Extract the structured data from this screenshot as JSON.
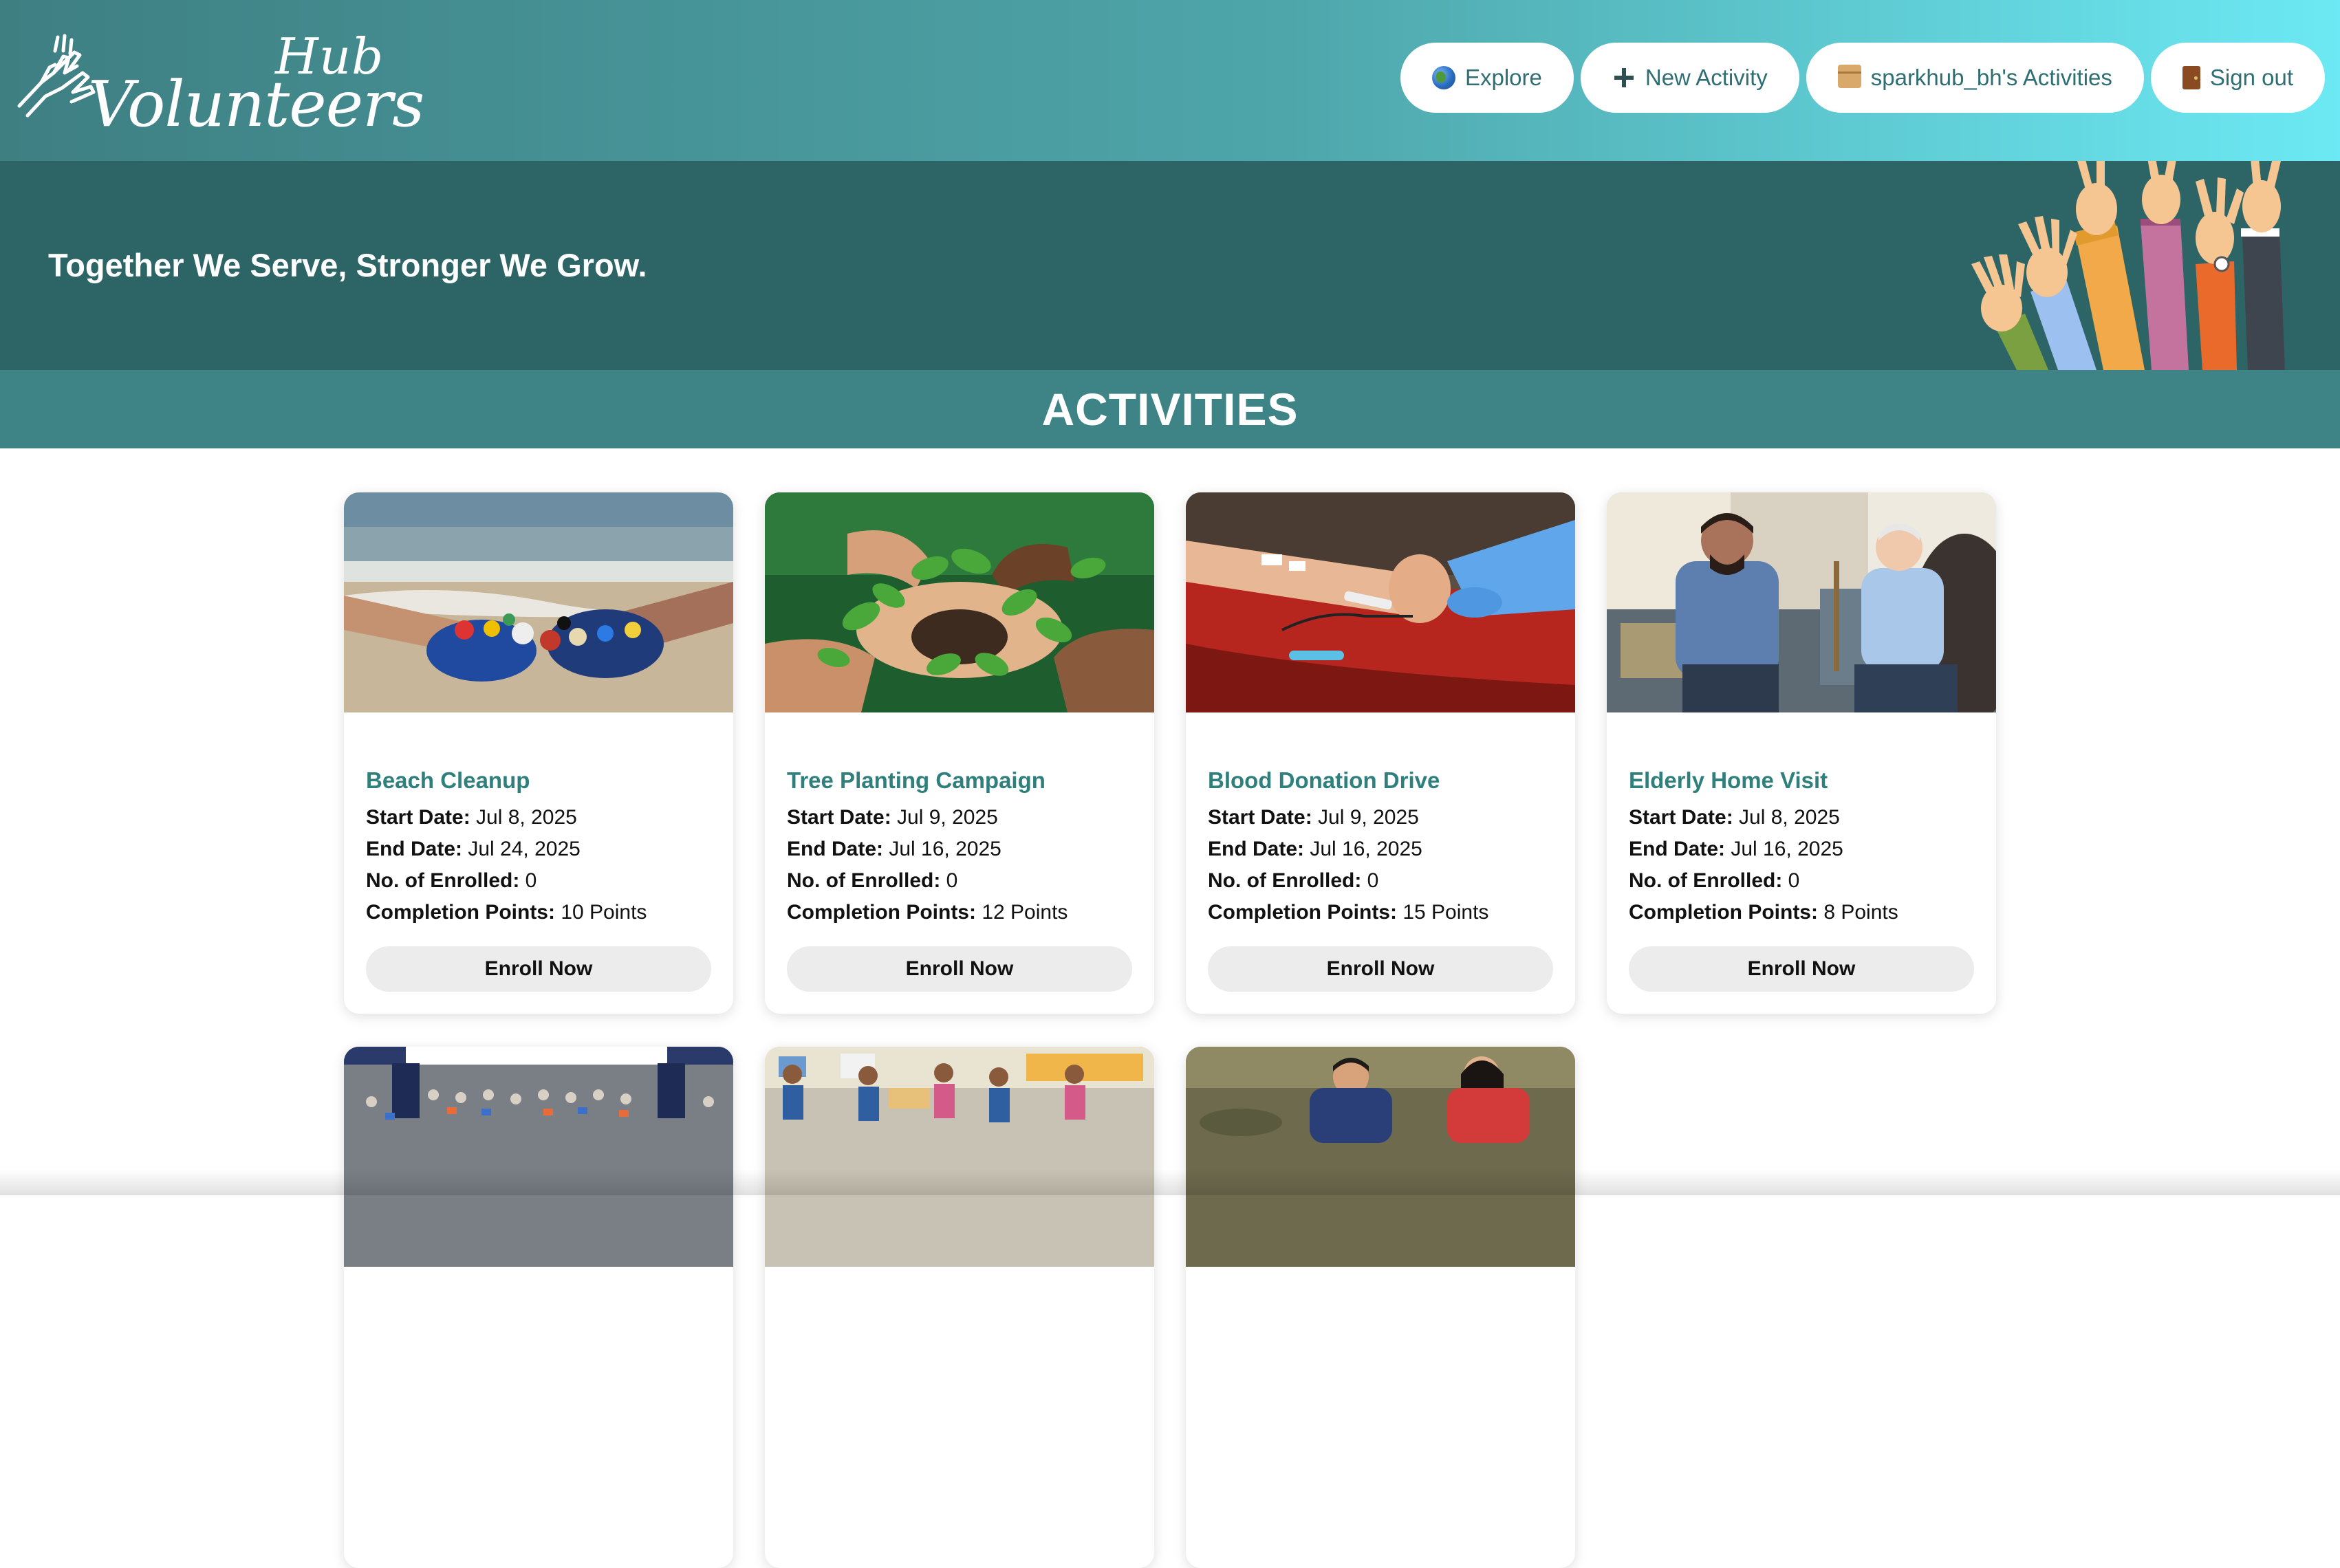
{
  "brand": {
    "logo_top": "Hub",
    "logo_bottom": "Volunteers"
  },
  "nav": {
    "explore": {
      "label": "Explore",
      "icon": "globe-icon"
    },
    "new_activity": {
      "label": "New Activity",
      "icon": "plus-icon"
    },
    "my_activities": {
      "label": "sparkhub_bh's Activities",
      "icon": "box-icon"
    },
    "sign_out": {
      "label": "Sign out",
      "icon": "door-icon"
    }
  },
  "hero": {
    "tagline": "Together We Serve, Stronger We Grow."
  },
  "section": {
    "title": "ACTIVITIES"
  },
  "labels": {
    "start_date": "Start Date:",
    "end_date": "End Date:",
    "enrolled": "No. of Enrolled:",
    "points": "Completion Points:",
    "enroll_button": "Enroll Now"
  },
  "activities": [
    {
      "title": "Beach Cleanup",
      "start_date": "Jul 8, 2025",
      "end_date": "Jul 24, 2025",
      "enrolled": "0",
      "points": "10 Points"
    },
    {
      "title": "Tree Planting Campaign",
      "start_date": "Jul 9, 2025",
      "end_date": "Jul 16, 2025",
      "enrolled": "0",
      "points": "12 Points"
    },
    {
      "title": "Blood Donation Drive",
      "start_date": "Jul 9, 2025",
      "end_date": "Jul 16, 2025",
      "enrolled": "0",
      "points": "15 Points"
    },
    {
      "title": "Elderly Home Visit",
      "start_date": "Jul 8, 2025",
      "end_date": "Jul 16, 2025",
      "enrolled": "0",
      "points": "8 Points"
    }
  ],
  "colors": {
    "nav_gradient_start": "#3e7f82",
    "nav_gradient_end": "#6ce9f4",
    "hero_bg": "#2d6567",
    "section_bg": "#3e8486",
    "card_title": "#2f7f7c",
    "button_bg": "#ececec"
  }
}
